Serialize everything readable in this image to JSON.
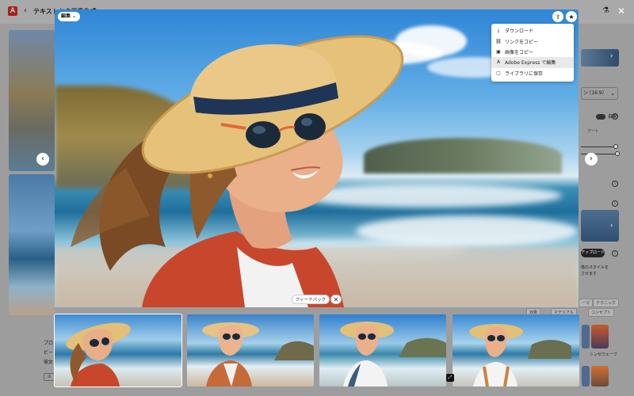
{
  "header": {
    "logo_glyph": "A",
    "back_glyph": "‹",
    "title": "テキストから画像生成",
    "close_glyph": "✕"
  },
  "right_panel": {
    "aspect_select": "ン (16.9)",
    "auto_label": "自動",
    "art_label": "アート",
    "upload_label": "アップロード",
    "style_text_1": "像のスタイルを",
    "style_text_2": "させます"
  },
  "bottom_tabs": [
    "効果",
    "マテリアル",
    "ーマ",
    "テクニック",
    "コンセプト"
  ],
  "bottom_left": {
    "line1": "プロ",
    "line2": "ビー",
    "line3": "彼女",
    "button_label": "ス"
  },
  "right_thumbs": {
    "label": "シンセウェーブ"
  },
  "modal": {
    "edit_label": "編集",
    "share_icon": "share-icon",
    "favorite_icon": "star-icon",
    "menu": [
      {
        "icon": "⤓",
        "label": "ダウンロード",
        "name": "download"
      },
      {
        "icon": "⛓",
        "label": "リンクをコピー",
        "name": "copy-link"
      },
      {
        "icon": "▣",
        "label": "画像をコピー",
        "name": "copy-image"
      },
      {
        "icon": "A",
        "label": "Adobe Express で編集",
        "name": "edit-in-adobe-express"
      },
      {
        "icon": "▢",
        "label": "ライブラリに保存",
        "name": "save-to-library"
      }
    ],
    "prev_glyph": "‹",
    "next_glyph": "›",
    "feedback_label": "フィードバック",
    "feedback_close": "✕"
  },
  "colors": {
    "accent": "#a3231b",
    "overlay": "#9d9d9d",
    "menu_bg": "#ffffff"
  }
}
